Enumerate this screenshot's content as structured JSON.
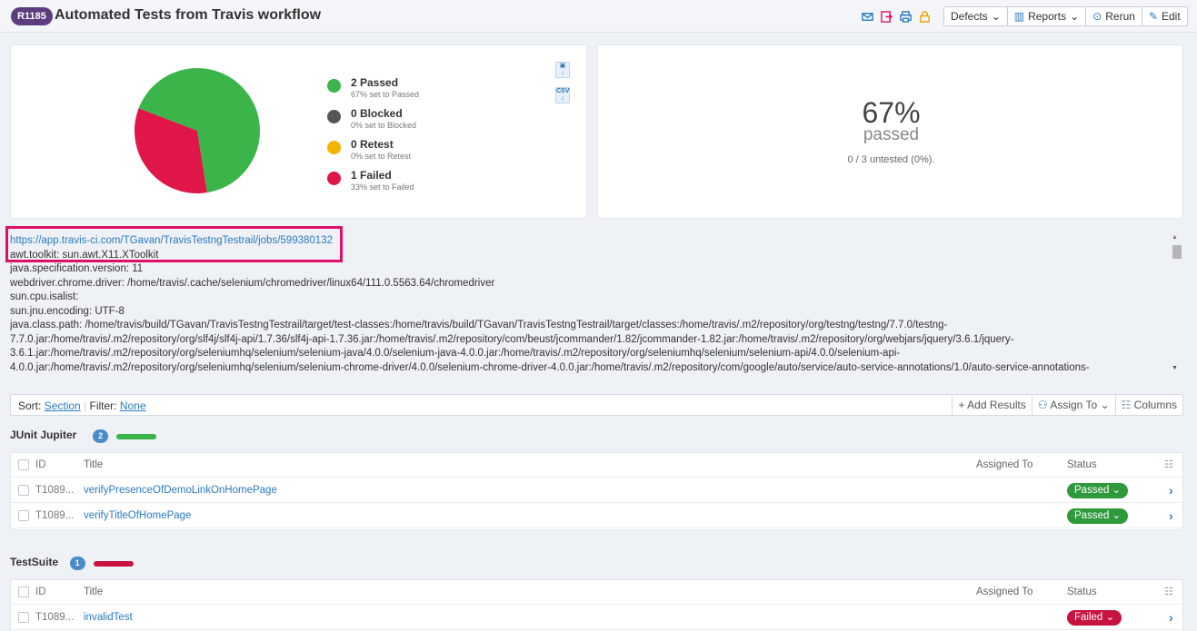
{
  "header": {
    "run_id": "R1185",
    "title": "Automated Tests from Travis workflow",
    "icons": [
      "mail-icon",
      "export-icon",
      "print-icon",
      "lock-icon"
    ],
    "defects_label": "Defects",
    "reports_label": "Reports",
    "rerun_label": "Rerun",
    "edit_label": "Edit"
  },
  "summary": {
    "download_csv_label": "CSV",
    "legend": [
      {
        "label": "2 Passed",
        "sub": "67% set to Passed",
        "color": "#3bb54a"
      },
      {
        "label": "0 Blocked",
        "sub": "0% set to Blocked",
        "color": "#555555"
      },
      {
        "label": "0 Retest",
        "sub": "0% set to Retest",
        "color": "#f5b400"
      },
      {
        "label": "1 Failed",
        "sub": "33% set to Failed",
        "color": "#e01548"
      }
    ],
    "pie": {
      "passed": 2,
      "failed": 1,
      "passed_color": "#3bb54a",
      "failed_color": "#e01548"
    },
    "percent": "67%",
    "percent_label": "passed",
    "untested": "0 / 3 untested (0%)."
  },
  "description": {
    "link": "https://app.travis-ci.com/TGavan/TravisTestngTestrail/jobs/599380132",
    "lines": [
      "awt.toolkit: sun.awt.X11.XToolkit",
      "java.specification.version: 11",
      "webdriver.chrome.driver: /home/travis/.cache/selenium/chromedriver/linux64/111.0.5563.64/chromedriver",
      "sun.cpu.isalist:",
      "sun.jnu.encoding: UTF-8",
      "java.class.path: /home/travis/build/TGavan/TravisTestngTestrail/target/test-classes:/home/travis/build/TGavan/TravisTestngTestrail/target/classes:/home/travis/.m2/repository/org/testng/testng/7.7.0/testng-",
      "7.7.0.jar:/home/travis/.m2/repository/org/slf4j/slf4j-api/1.7.36/slf4j-api-1.7.36.jar:/home/travis/.m2/repository/com/beust/jcommander/1.82/jcommander-1.82.jar:/home/travis/.m2/repository/org/webjars/jquery/3.6.1/jquery-",
      "3.6.1.jar:/home/travis/.m2/repository/org/seleniumhq/selenium/selenium-java/4.0.0/selenium-java-4.0.0.jar:/home/travis/.m2/repository/org/seleniumhq/selenium/selenium-api/4.0.0/selenium-api-",
      "4.0.0.jar:/home/travis/.m2/repository/org/seleniumhq/selenium/selenium-chrome-driver/4.0.0/selenium-chrome-driver-4.0.0.jar:/home/travis/.m2/repository/com/google/auto/service/auto-service-annotations/1.0/auto-service-annotations-"
    ]
  },
  "filter_bar": {
    "sort_label": "Sort:",
    "sort_value": "Section",
    "filter_label": "Filter:",
    "filter_value": "None",
    "add_results": "+ Add Results",
    "assign_to": "Assign To",
    "columns": "Columns"
  },
  "columns": {
    "id": "ID",
    "title": "Title",
    "assigned": "Assigned To",
    "status": "Status"
  },
  "sections": [
    {
      "name": "JUnit Jupiter",
      "count": "2",
      "bar_color": "#3bb54a",
      "rows": [
        {
          "id": "T1089...",
          "title": "verifyPresenceOfDemoLinkOnHomePage",
          "status": "Passed",
          "status_color": "#2e9a3c"
        },
        {
          "id": "T1089...",
          "title": "verifyTitleOfHomePage",
          "status": "Passed",
          "status_color": "#2e9a3c"
        }
      ]
    },
    {
      "name": "TestSuite",
      "count": "1",
      "bar_color": "#c8123f",
      "rows": [
        {
          "id": "T1089...",
          "title": "invalidTest",
          "status": "Failed",
          "status_color": "#c8123f"
        }
      ]
    }
  ]
}
